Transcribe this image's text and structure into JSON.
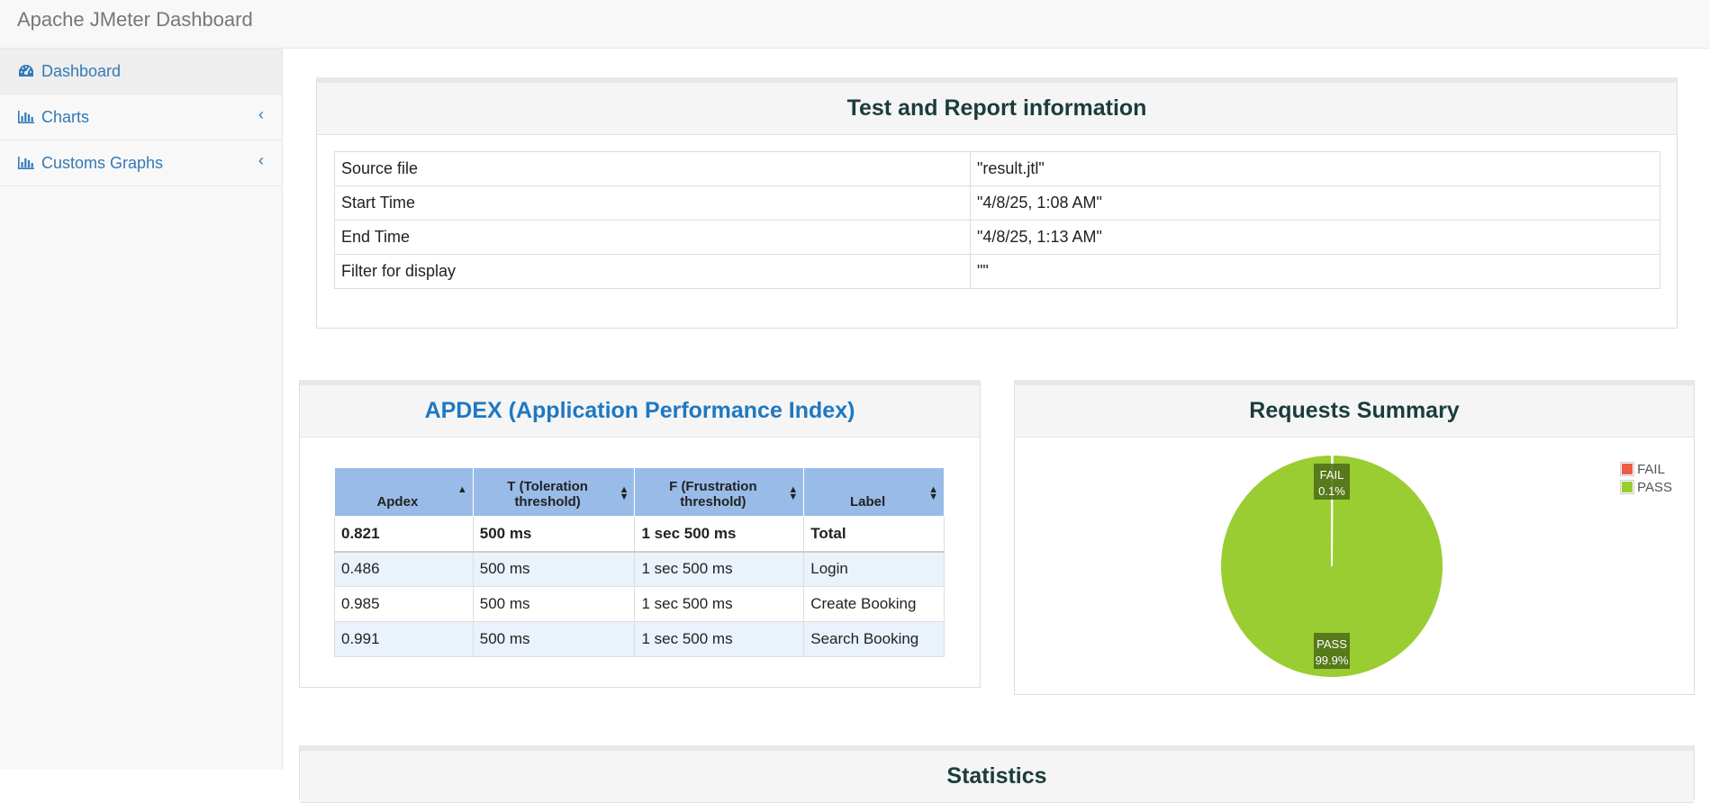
{
  "app": {
    "title": "Apache JMeter Dashboard"
  },
  "sidebar": {
    "items": [
      {
        "label": "Dashboard",
        "icon": "dashboard-icon"
      },
      {
        "label": "Charts",
        "icon": "bar-chart-icon",
        "chevron": "‹"
      },
      {
        "label": "Customs Graphs",
        "icon": "bar-chart-icon",
        "chevron": "‹"
      }
    ]
  },
  "test_info": {
    "title": "Test and Report information",
    "rows": [
      {
        "key": "Source file",
        "value": "\"result.jtl\""
      },
      {
        "key": "Start Time",
        "value": "\"4/8/25, 1:08 AM\""
      },
      {
        "key": "End Time",
        "value": "\"4/8/25, 1:13 AM\""
      },
      {
        "key": "Filter for display",
        "value": "\"\""
      }
    ]
  },
  "apdex": {
    "title": "APDEX (Application Performance Index)",
    "headers": [
      "Apdex",
      "T (Toleration threshold)",
      "F (Frustration threshold)",
      "Label"
    ],
    "rows": [
      [
        "0.821",
        "500 ms",
        "1 sec 500 ms",
        "Total"
      ],
      [
        "0.486",
        "500 ms",
        "1 sec 500 ms",
        "Login"
      ],
      [
        "0.985",
        "500 ms",
        "1 sec 500 ms",
        "Create Booking"
      ],
      [
        "0.991",
        "500 ms",
        "1 sec 500 ms",
        "Search Booking"
      ]
    ]
  },
  "requests_summary": {
    "title": "Requests Summary",
    "legend": [
      {
        "label": "FAIL",
        "color": "#ee5c45"
      },
      {
        "label": "PASS",
        "color": "#9acd32"
      }
    ]
  },
  "chart_data": {
    "type": "pie",
    "categories": [
      "FAIL",
      "PASS"
    ],
    "values": [
      0.1,
      99.9
    ],
    "data_labels": [
      "0.1%",
      "99.9%"
    ],
    "colors": [
      "#ee5c45",
      "#9acd32"
    ],
    "legend_position": "top-right"
  },
  "statistics": {
    "title": "Statistics"
  }
}
